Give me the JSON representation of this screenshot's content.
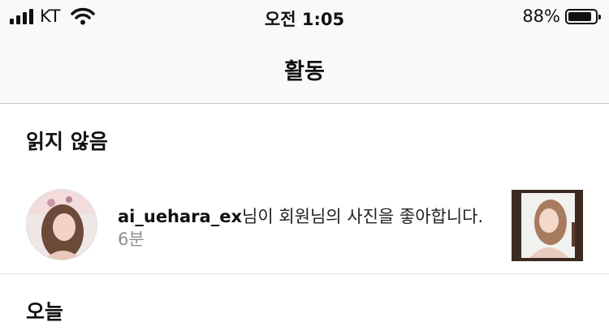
{
  "status_bar": {
    "carrier": "KT",
    "time": "오전 1:05",
    "battery_percent": "88%",
    "battery_level": 0.88
  },
  "nav": {
    "title": "활동"
  },
  "sections": {
    "unread": "읽지 않음",
    "today": "오늘"
  },
  "notification": {
    "username": "ai_uehara_ex",
    "text": "님이 회원님의 사진을 좋아합니다.",
    "time_ago": "6분"
  }
}
